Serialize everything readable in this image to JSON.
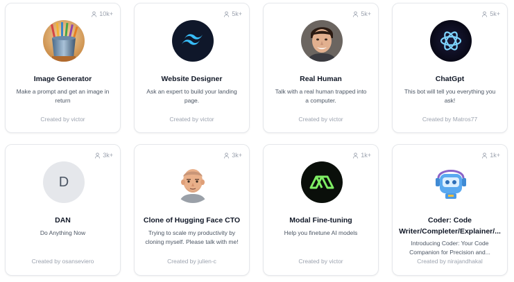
{
  "bots": [
    {
      "title": "Image Generator",
      "description": "Make a prompt and get an image in return",
      "creator": "Created by victor",
      "users": "10k+",
      "avatar_icon": "paint-bucket-icon"
    },
    {
      "title": "Website Designer",
      "description": "Ask an expert to build your landing page.",
      "creator": "Created by victor",
      "users": "5k+",
      "avatar_icon": "tailwind-logo-icon"
    },
    {
      "title": "Real Human",
      "description": "Talk with a real human trapped into a computer.",
      "creator": "Created by victor",
      "users": "5k+",
      "avatar_icon": "human-face-icon"
    },
    {
      "title": "ChatGpt",
      "description": "This bot will tell you everything you ask!",
      "creator": "Created by Matros77",
      "users": "5k+",
      "avatar_icon": "openai-logo-icon"
    },
    {
      "title": "DAN",
      "description": "Do Anything Now",
      "creator": "Created by osanseviero",
      "users": "3k+",
      "avatar_letter": "D"
    },
    {
      "title": "Clone of Hugging Face CTO",
      "description": "Trying to scale my productivity by cloning myself. Please talk with me!",
      "creator": "Created by julien-c",
      "users": "3k+",
      "avatar_icon": "memoji-avatar-icon"
    },
    {
      "title": "Modal Fine-tuning",
      "description": "Help you finetune AI models",
      "creator": "Created by victor",
      "users": "1k+",
      "avatar_icon": "modal-logo-icon"
    },
    {
      "title": "Coder: Code Writer/Completer/Explainer/...",
      "description": "Introducing Coder: Your Code Companion for Precision and...",
      "creator": "Created by nirajandhakal",
      "users": "1k+",
      "avatar_icon": "robot-icon"
    }
  ],
  "colors": {
    "tailwind_bg": "#0f172a",
    "tailwind_accent": "#38bdf8",
    "openai_bg": "#0b0b1a",
    "openai_stroke": "#7dd3fc",
    "modal_bg": "#0a0f0a",
    "modal_green": "#7fee64",
    "dan_bg": "#e5e7eb",
    "dan_text": "#4b5563"
  }
}
